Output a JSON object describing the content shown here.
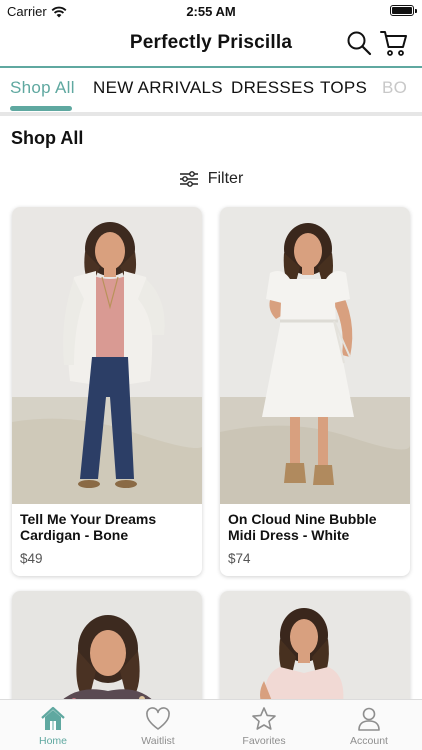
{
  "status_bar": {
    "carrier": "Carrier",
    "time": "2:55 AM"
  },
  "header": {
    "title": "Perfectly Priscilla"
  },
  "tabs": [
    {
      "label": "Shop All",
      "active": true
    },
    {
      "label": "NEW ARRIVALS",
      "active": false
    },
    {
      "label": "DRESSES",
      "active": false
    },
    {
      "label": "TOPS",
      "active": false
    },
    {
      "label": "BO",
      "active": false
    }
  ],
  "section_title": "Shop All",
  "filter_label": "Filter",
  "products": [
    {
      "name": "Tell Me Your Dreams Cardigan - Bone",
      "price": "$49"
    },
    {
      "name": "On Cloud Nine Bubble Midi Dress - White",
      "price": "$74"
    },
    {
      "name": "",
      "price": ""
    },
    {
      "name": "",
      "price": ""
    }
  ],
  "tabbar": [
    {
      "label": "Home",
      "icon": "home-icon",
      "active": true
    },
    {
      "label": "Waitlist",
      "icon": "heart-icon",
      "active": false
    },
    {
      "label": "Favorites",
      "icon": "star-icon",
      "active": false
    },
    {
      "label": "Account",
      "icon": "person-icon",
      "active": false
    }
  ],
  "colors": {
    "accent": "#5fa8a0",
    "text": "#111111",
    "muted": "#8e8e8e"
  }
}
